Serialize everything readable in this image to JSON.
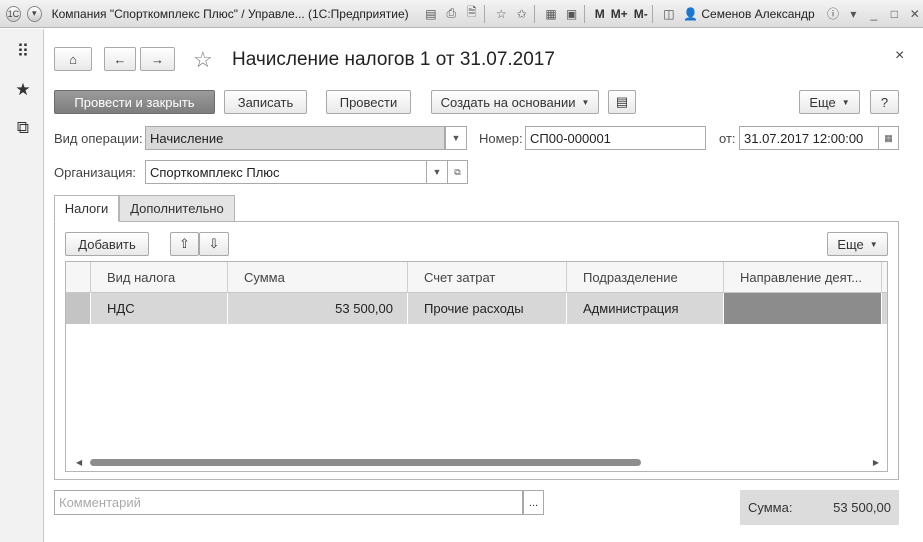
{
  "titlebar": {
    "title": "Компания \"Спорткомплекс Плюс\" / Управле... (1С:Предприятие)",
    "m1": "M",
    "m2": "M+",
    "m3": "M-",
    "user": "Семенов Александр"
  },
  "form": {
    "heading": "Начисление налогов 1 от 31.07.2017",
    "buttons": {
      "post_close": "Провести и закрыть",
      "save": "Записать",
      "post": "Провести",
      "create_based": "Создать на основании",
      "more": "Еще",
      "help": "?"
    },
    "fields": {
      "operation_label": "Вид операции:",
      "operation_value": "Начисление",
      "number_label": "Номер:",
      "number_value": "СП00-000001",
      "date_label": "от:",
      "date_value": "31.07.2017 12:00:00",
      "org_label": "Организация:",
      "org_value": "Спорткомплекс Плюс"
    },
    "tabs": [
      "Налоги",
      "Дополнительно"
    ],
    "table_toolbar": {
      "add": "Добавить",
      "more": "Еще"
    },
    "table": {
      "columns": [
        "Вид налога",
        "Сумма",
        "Счет затрат",
        "Подразделение",
        "Направление деят..."
      ],
      "rows": [
        [
          "НДС",
          "53 500,00",
          "Прочие расходы",
          "Администрация",
          ""
        ]
      ]
    },
    "comment_placeholder": "Комментарий",
    "comment_btn": "...",
    "sum_label": "Сумма:",
    "sum_value": "53 500,00"
  }
}
